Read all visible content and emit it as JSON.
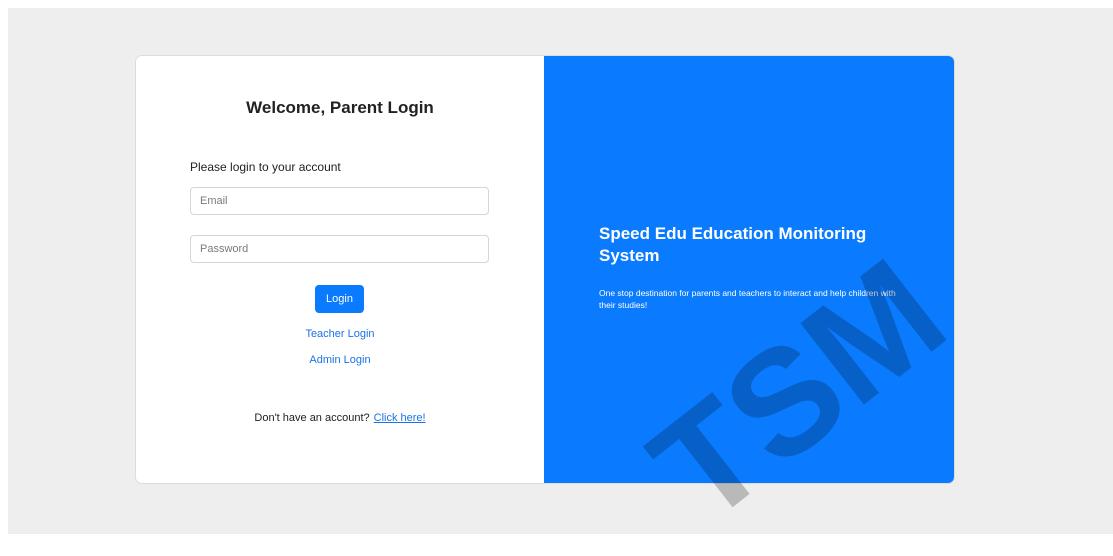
{
  "login_form": {
    "title": "Welcome, Parent Login",
    "prompt": "Please login to your account",
    "email_placeholder": "Email",
    "password_placeholder": "Password",
    "login_label": "Login",
    "teacher_login_label": "Teacher Login",
    "admin_login_label": "Admin Login",
    "signup_prompt": "Don't have an account?",
    "signup_link_label": "Click here!"
  },
  "brand_panel": {
    "title": "Speed Edu Education Monitoring System",
    "tagline": "One stop destination for parents and teachers to interact and help children with their studies!"
  },
  "watermark": {
    "text": "TSM"
  },
  "colors": {
    "accent": "#0a7bff",
    "link": "#1a73e8",
    "page_background": "#eeeeee"
  }
}
